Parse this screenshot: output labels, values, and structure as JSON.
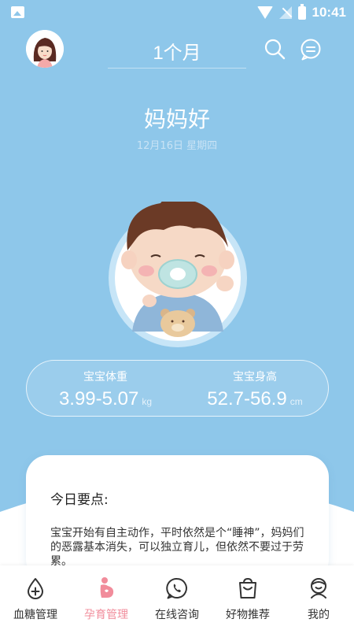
{
  "status_bar": {
    "time": "10:41"
  },
  "header": {
    "title": "1个月"
  },
  "greeting": "妈妈好",
  "date": "12月16日 星期四",
  "stats": {
    "weight": {
      "label": "宝宝体重",
      "value": "3.99-5.07",
      "unit": "kg"
    },
    "height": {
      "label": "宝宝身高",
      "value": "52.7-56.9",
      "unit": "cm"
    }
  },
  "tips": {
    "title": "今日要点:",
    "body": "宝宝开始有自主动作，平时依然是个“睡神”，妈妈们的恶露基本消失，可以独立育儿，但依然不要过于劳累。"
  },
  "nav": {
    "items": [
      {
        "label": "血糖管理",
        "icon": "blood-sugar-icon"
      },
      {
        "label": "孕育管理",
        "icon": "pregnancy-icon",
        "active": true
      },
      {
        "label": "在线咨询",
        "icon": "chat-phone-icon"
      },
      {
        "label": "好物推荐",
        "icon": "shopping-bag-icon"
      },
      {
        "label": "我的",
        "icon": "profile-icon"
      }
    ]
  },
  "colors": {
    "background": "#8ec7ea",
    "accent": "#f18c9b",
    "text": "#333333"
  }
}
